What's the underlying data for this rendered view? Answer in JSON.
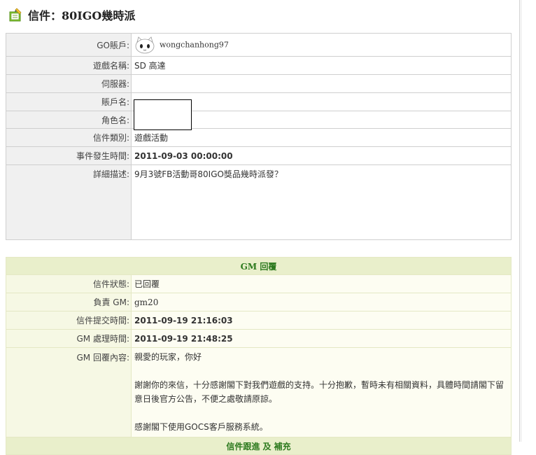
{
  "page": {
    "title": "信件：80IGO幾時派"
  },
  "info": {
    "account_label": "GO賬戶:",
    "account_value": "wongchanhong97",
    "game_label": "遊戲名稱:",
    "game_value": "SD 高達",
    "server_label": "伺服器:",
    "server_value": "",
    "username_label": "賬戶名:",
    "charname_label": "角色名:",
    "category_label": "信件類別:",
    "category_value": "遊戲活動",
    "event_time_label": "事件發生時間:",
    "event_time_value": "2011-09-03 00:00:00",
    "desc_label": "詳細描述:",
    "desc_value": "9月3號FB活動哥80IGO獎品幾時派發？"
  },
  "gm": {
    "header": "GM 回覆",
    "status_label": "信件狀態:",
    "status_value": "已回覆",
    "gm_label": "負責 GM:",
    "gm_value": "gm20",
    "submit_time_label": "信件提交時間:",
    "submit_time_value": "2011-09-19 21:16:03",
    "process_time_label": "GM 處理時間:",
    "process_time_value": "2011-09-19 21:48:25",
    "reply_label": "GM 回覆內容:",
    "reply_line1": "親愛的玩家，你好",
    "reply_line2": "謝謝你的來信，十分感謝閣下對我們遊戲的支持。十分抱歉，暫時未有相關資料，具體時間請閣下留",
    "reply_line3": "意日後官方公告，不便之處敬請原諒。",
    "reply_line4": "感謝閣下使用GOCS客戶服務系統。",
    "followup_header": "信件跟進 及 補充"
  },
  "colors": {
    "orange": "#e06c00",
    "gm_header_bg": "#e9efcb",
    "gm_header_text": "#2d7a1e"
  },
  "icons": {
    "title": "mail-book-icon",
    "avatar": "cat-face-avatar"
  }
}
